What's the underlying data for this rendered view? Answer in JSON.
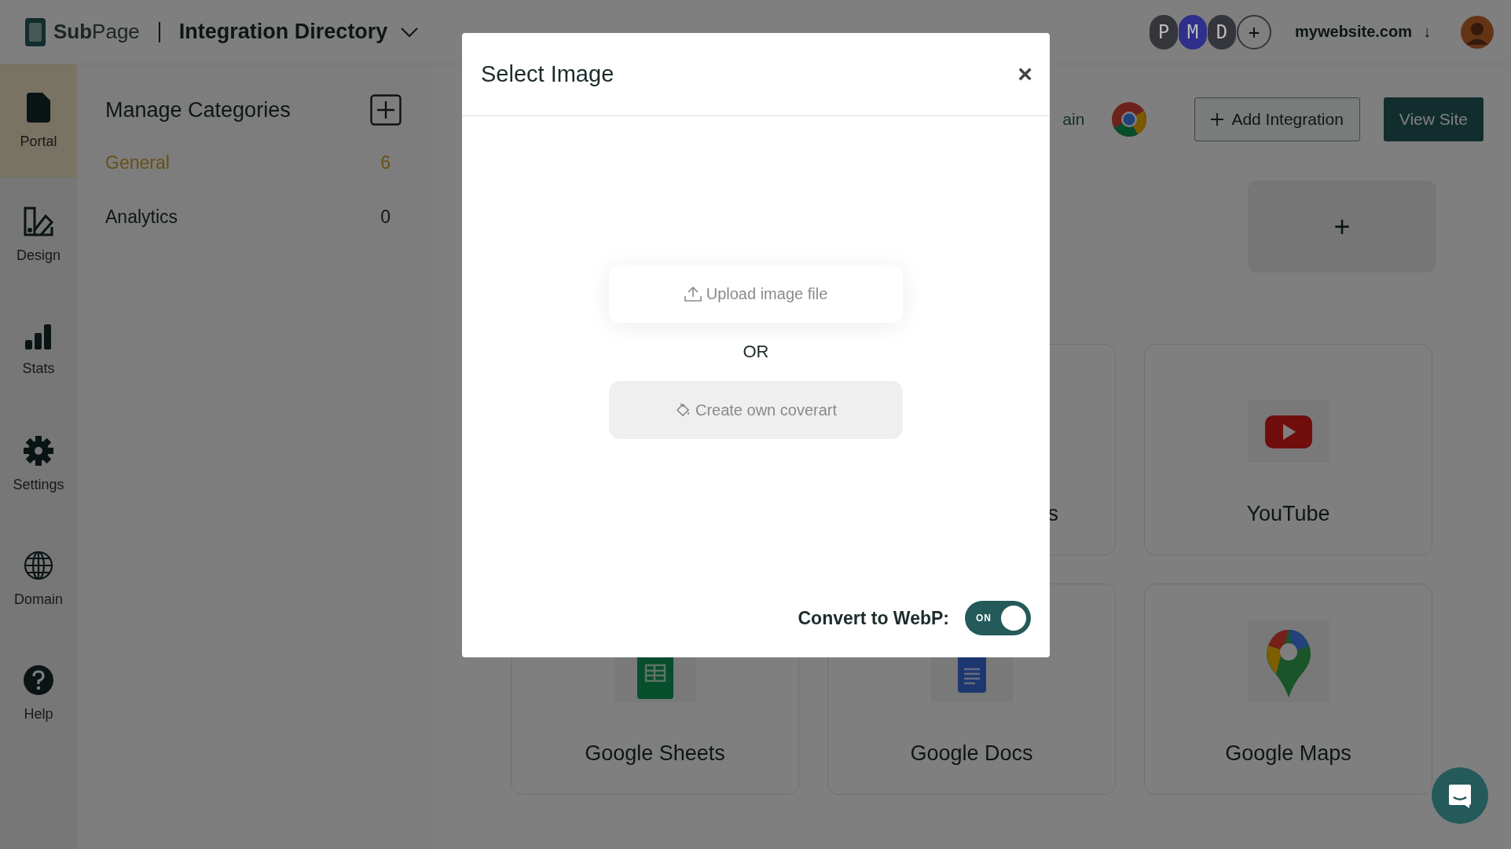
{
  "topbar": {
    "logo": "**Sub**Page",
    "title": "Integration Directory",
    "collaborators": [
      {
        "initial": "P",
        "color": "#35353c"
      },
      {
        "initial": "M",
        "color": "#2f2f8c"
      },
      {
        "initial": "D",
        "color": "#35353c"
      }
    ],
    "add_collaborator": "+",
    "site": "mywebsite.com",
    "site_arrow": "↓"
  },
  "nav": [
    {
      "label": "Portal",
      "selected": true
    },
    {
      "label": "Design",
      "selected": false
    },
    {
      "label": "Stats",
      "selected": false
    },
    {
      "label": "Settings",
      "selected": false
    },
    {
      "label": "Domain",
      "selected": false
    },
    {
      "label": "Help",
      "selected": false
    }
  ],
  "categories": {
    "title": "Manage Categories",
    "items": [
      {
        "name": "General",
        "count": "6",
        "selected": true
      },
      {
        "name": "Analytics",
        "count": "0",
        "selected": false
      }
    ]
  },
  "main": {
    "cut_text": "ain",
    "buttons": [
      {
        "label": "Add Integration",
        "kind": "outline"
      },
      {
        "label": "View Site",
        "kind": "primary"
      }
    ],
    "add_card": "+",
    "cards": [
      {
        "kind": "partial",
        "name": "s"
      },
      {
        "kind": "app",
        "name": "YouTube"
      },
      {
        "kind": "app",
        "name": "Google Sheets"
      },
      {
        "kind": "app",
        "name": "Google Docs"
      },
      {
        "kind": "app",
        "name": "Google Maps"
      }
    ]
  },
  "modal": {
    "title": "Select Image",
    "close": "×",
    "upload": "Upload image file",
    "or": "OR",
    "create": "Create own coverart",
    "webp": {
      "label": "Convert to WebP:",
      "toggle": "ON",
      "on": true
    }
  }
}
